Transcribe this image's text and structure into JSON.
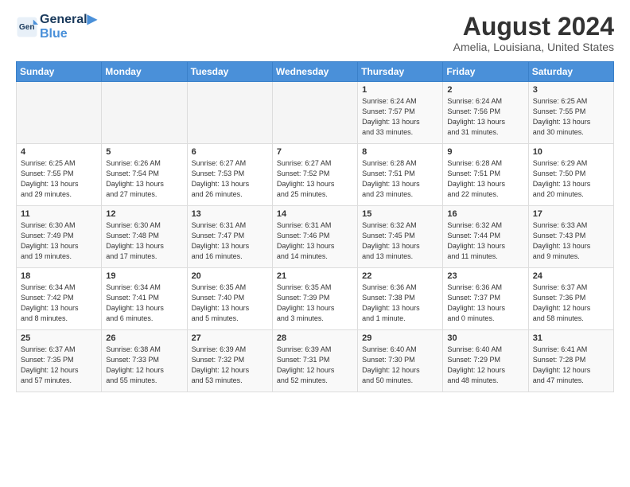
{
  "logo": {
    "line1": "General",
    "line2": "Blue"
  },
  "title": "August 2024",
  "location": "Amelia, Louisiana, United States",
  "weekdays": [
    "Sunday",
    "Monday",
    "Tuesday",
    "Wednesday",
    "Thursday",
    "Friday",
    "Saturday"
  ],
  "weeks": [
    [
      {
        "day": "",
        "info": ""
      },
      {
        "day": "",
        "info": ""
      },
      {
        "day": "",
        "info": ""
      },
      {
        "day": "",
        "info": ""
      },
      {
        "day": "1",
        "info": "Sunrise: 6:24 AM\nSunset: 7:57 PM\nDaylight: 13 hours\nand 33 minutes."
      },
      {
        "day": "2",
        "info": "Sunrise: 6:24 AM\nSunset: 7:56 PM\nDaylight: 13 hours\nand 31 minutes."
      },
      {
        "day": "3",
        "info": "Sunrise: 6:25 AM\nSunset: 7:55 PM\nDaylight: 13 hours\nand 30 minutes."
      }
    ],
    [
      {
        "day": "4",
        "info": "Sunrise: 6:25 AM\nSunset: 7:55 PM\nDaylight: 13 hours\nand 29 minutes."
      },
      {
        "day": "5",
        "info": "Sunrise: 6:26 AM\nSunset: 7:54 PM\nDaylight: 13 hours\nand 27 minutes."
      },
      {
        "day": "6",
        "info": "Sunrise: 6:27 AM\nSunset: 7:53 PM\nDaylight: 13 hours\nand 26 minutes."
      },
      {
        "day": "7",
        "info": "Sunrise: 6:27 AM\nSunset: 7:52 PM\nDaylight: 13 hours\nand 25 minutes."
      },
      {
        "day": "8",
        "info": "Sunrise: 6:28 AM\nSunset: 7:51 PM\nDaylight: 13 hours\nand 23 minutes."
      },
      {
        "day": "9",
        "info": "Sunrise: 6:28 AM\nSunset: 7:51 PM\nDaylight: 13 hours\nand 22 minutes."
      },
      {
        "day": "10",
        "info": "Sunrise: 6:29 AM\nSunset: 7:50 PM\nDaylight: 13 hours\nand 20 minutes."
      }
    ],
    [
      {
        "day": "11",
        "info": "Sunrise: 6:30 AM\nSunset: 7:49 PM\nDaylight: 13 hours\nand 19 minutes."
      },
      {
        "day": "12",
        "info": "Sunrise: 6:30 AM\nSunset: 7:48 PM\nDaylight: 13 hours\nand 17 minutes."
      },
      {
        "day": "13",
        "info": "Sunrise: 6:31 AM\nSunset: 7:47 PM\nDaylight: 13 hours\nand 16 minutes."
      },
      {
        "day": "14",
        "info": "Sunrise: 6:31 AM\nSunset: 7:46 PM\nDaylight: 13 hours\nand 14 minutes."
      },
      {
        "day": "15",
        "info": "Sunrise: 6:32 AM\nSunset: 7:45 PM\nDaylight: 13 hours\nand 13 minutes."
      },
      {
        "day": "16",
        "info": "Sunrise: 6:32 AM\nSunset: 7:44 PM\nDaylight: 13 hours\nand 11 minutes."
      },
      {
        "day": "17",
        "info": "Sunrise: 6:33 AM\nSunset: 7:43 PM\nDaylight: 13 hours\nand 9 minutes."
      }
    ],
    [
      {
        "day": "18",
        "info": "Sunrise: 6:34 AM\nSunset: 7:42 PM\nDaylight: 13 hours\nand 8 minutes."
      },
      {
        "day": "19",
        "info": "Sunrise: 6:34 AM\nSunset: 7:41 PM\nDaylight: 13 hours\nand 6 minutes."
      },
      {
        "day": "20",
        "info": "Sunrise: 6:35 AM\nSunset: 7:40 PM\nDaylight: 13 hours\nand 5 minutes."
      },
      {
        "day": "21",
        "info": "Sunrise: 6:35 AM\nSunset: 7:39 PM\nDaylight: 13 hours\nand 3 minutes."
      },
      {
        "day": "22",
        "info": "Sunrise: 6:36 AM\nSunset: 7:38 PM\nDaylight: 13 hours\nand 1 minute."
      },
      {
        "day": "23",
        "info": "Sunrise: 6:36 AM\nSunset: 7:37 PM\nDaylight: 13 hours\nand 0 minutes."
      },
      {
        "day": "24",
        "info": "Sunrise: 6:37 AM\nSunset: 7:36 PM\nDaylight: 12 hours\nand 58 minutes."
      }
    ],
    [
      {
        "day": "25",
        "info": "Sunrise: 6:37 AM\nSunset: 7:35 PM\nDaylight: 12 hours\nand 57 minutes."
      },
      {
        "day": "26",
        "info": "Sunrise: 6:38 AM\nSunset: 7:33 PM\nDaylight: 12 hours\nand 55 minutes."
      },
      {
        "day": "27",
        "info": "Sunrise: 6:39 AM\nSunset: 7:32 PM\nDaylight: 12 hours\nand 53 minutes."
      },
      {
        "day": "28",
        "info": "Sunrise: 6:39 AM\nSunset: 7:31 PM\nDaylight: 12 hours\nand 52 minutes."
      },
      {
        "day": "29",
        "info": "Sunrise: 6:40 AM\nSunset: 7:30 PM\nDaylight: 12 hours\nand 50 minutes."
      },
      {
        "day": "30",
        "info": "Sunrise: 6:40 AM\nSunset: 7:29 PM\nDaylight: 12 hours\nand 48 minutes."
      },
      {
        "day": "31",
        "info": "Sunrise: 6:41 AM\nSunset: 7:28 PM\nDaylight: 12 hours\nand 47 minutes."
      }
    ]
  ]
}
